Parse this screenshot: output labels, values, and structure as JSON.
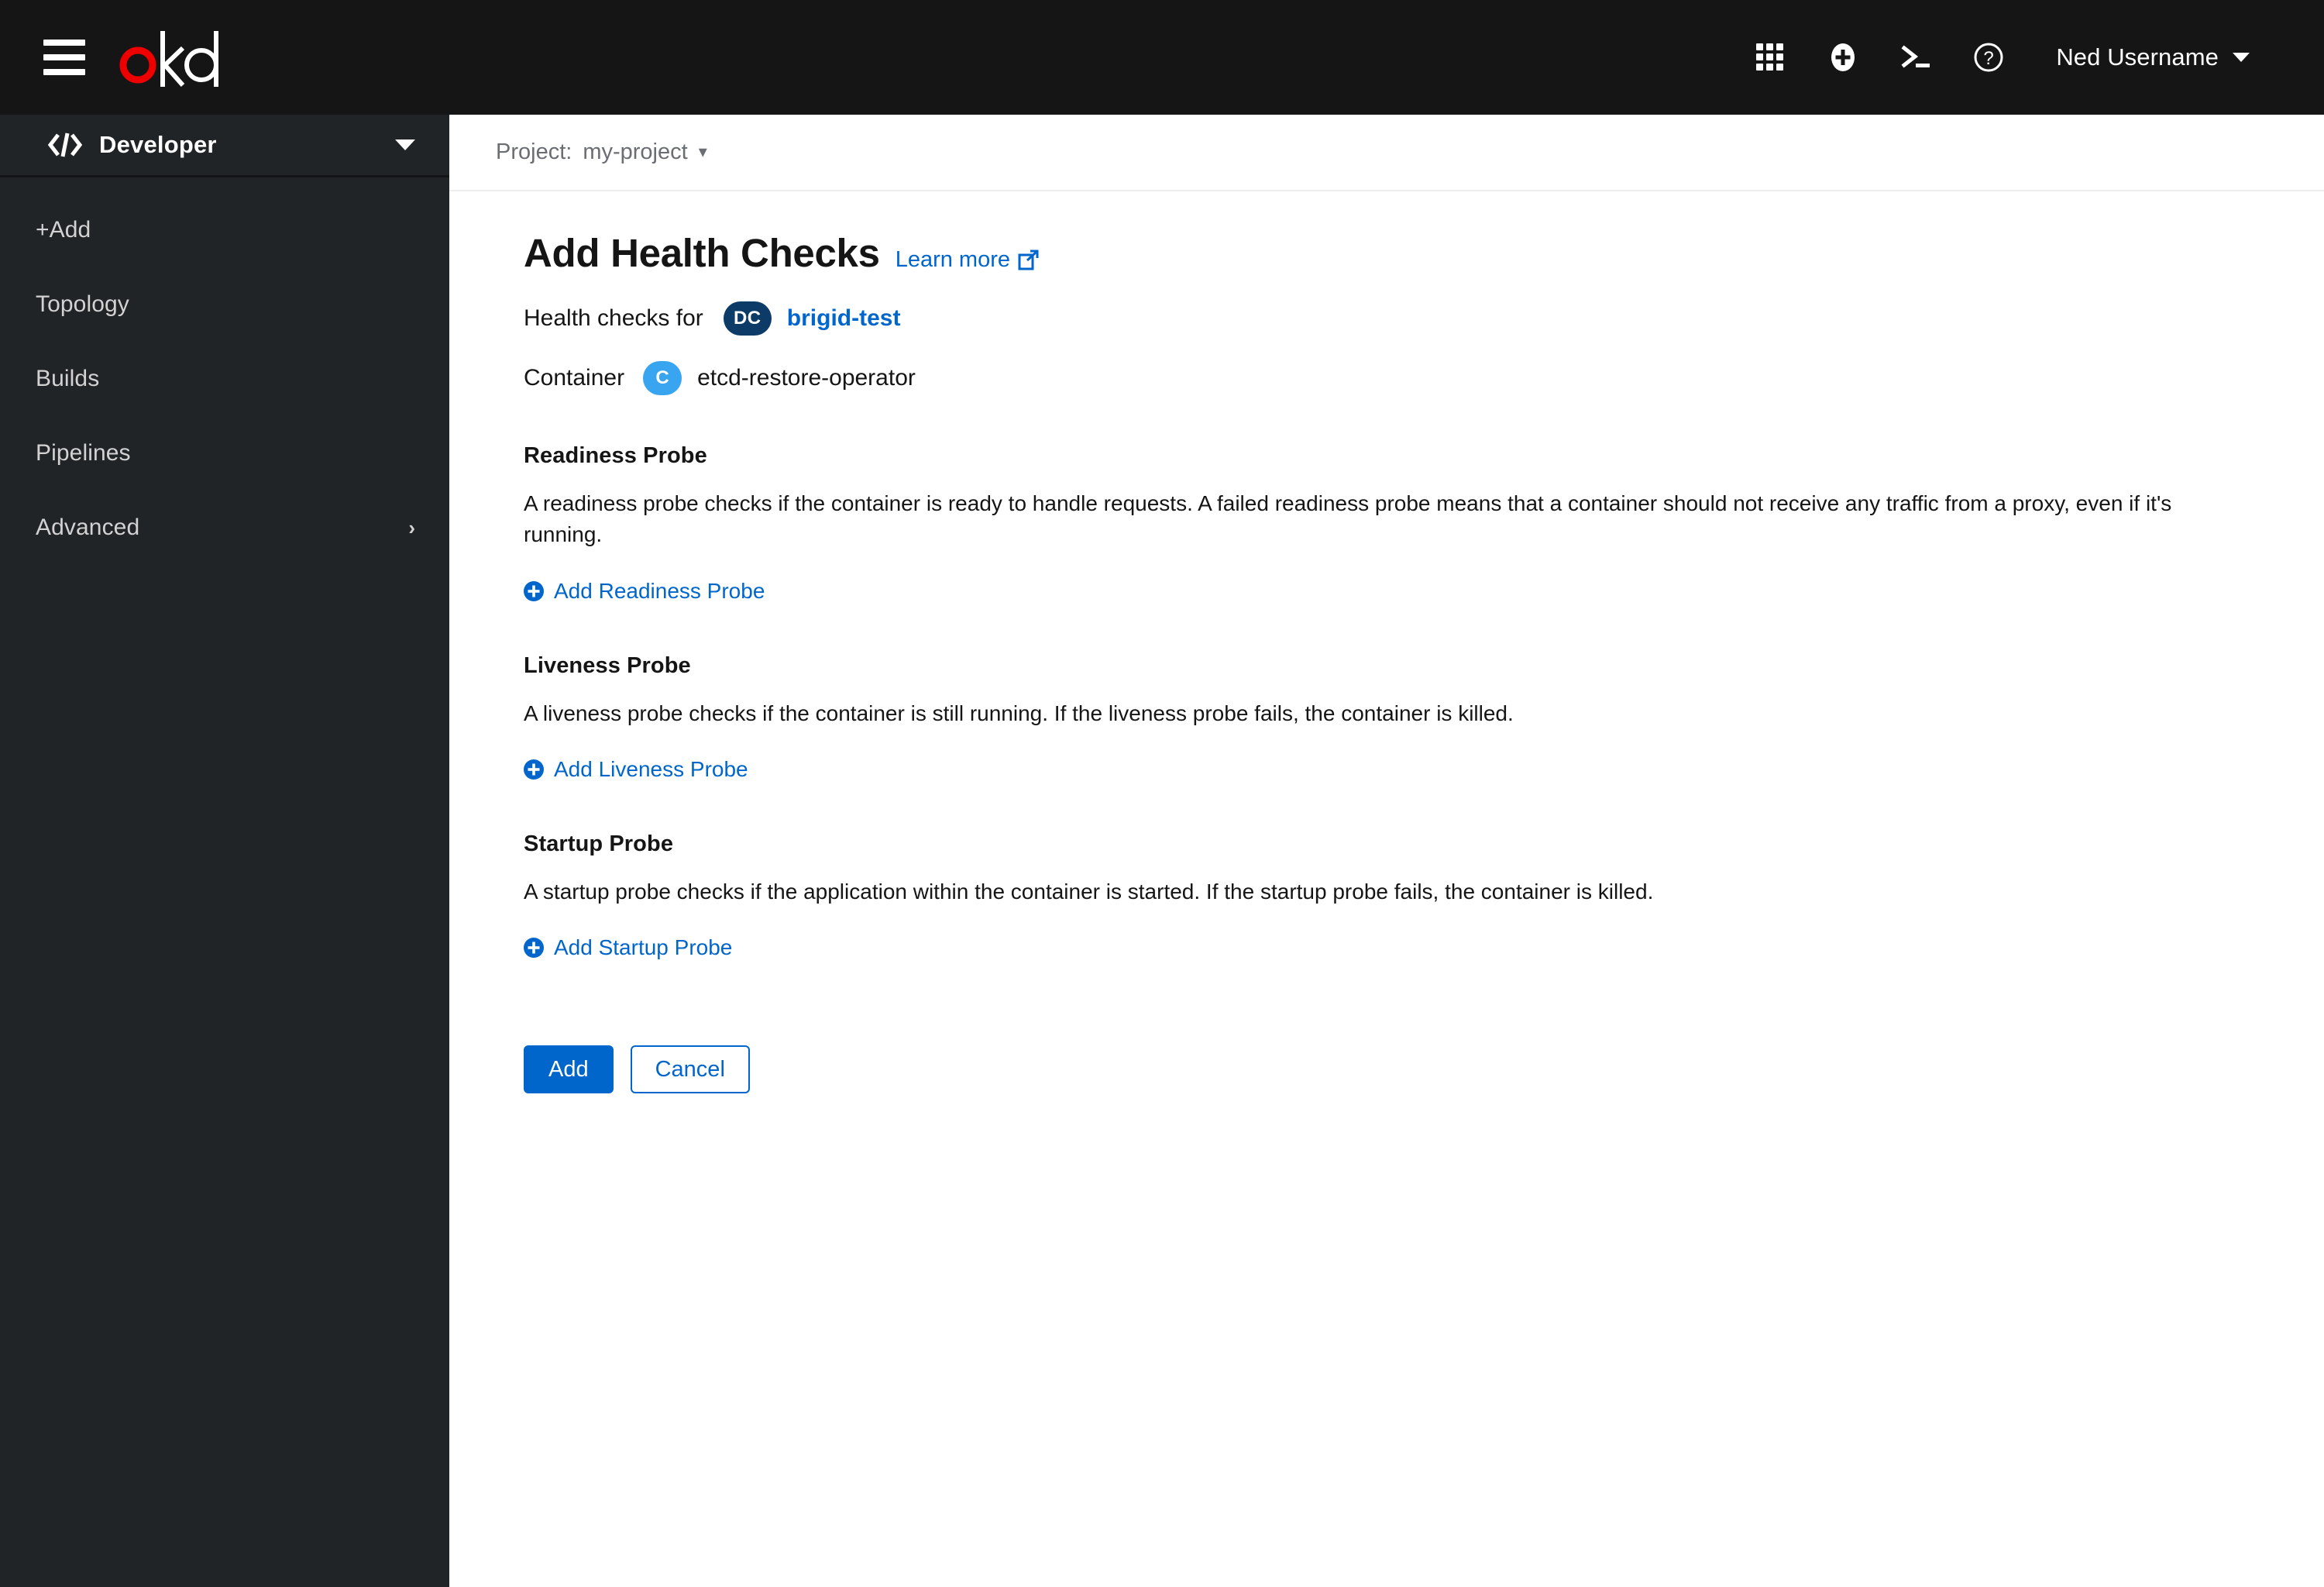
{
  "masthead": {
    "menu_icon": "hamburger-icon",
    "brand_name": "okd",
    "brand_colors": {
      "accent": "#ee0000",
      "text": "#ffffff"
    },
    "tools": [
      {
        "name": "application-launcher-icon",
        "label": "Application launcher"
      },
      {
        "name": "plus-circle-icon",
        "label": "Quick create"
      },
      {
        "name": "terminal-icon",
        "label": "Cloud shell"
      },
      {
        "name": "help-icon",
        "label": "Help"
      }
    ],
    "user": {
      "name": "Ned Username",
      "caret": "chevron-down-icon"
    }
  },
  "sidebar": {
    "perspective": {
      "icon": "code-icon",
      "label": "Developer",
      "caret": "chevron-down-icon"
    },
    "items": [
      {
        "label": "+Add",
        "has_chevron": false
      },
      {
        "label": "Topology",
        "has_chevron": false
      },
      {
        "label": "Builds",
        "has_chevron": false
      },
      {
        "label": "Pipelines",
        "has_chevron": false
      },
      {
        "label": "Advanced",
        "has_chevron": true,
        "chevron": "›"
      }
    ]
  },
  "project_bar": {
    "label": "Project:",
    "value": "my-project",
    "caret": "▾"
  },
  "page": {
    "title": "Add Health Checks",
    "learn_more": "Learn more",
    "learn_more_icon": "external-link-icon",
    "resource": {
      "prefix": "Health checks for",
      "badge": "DC",
      "badge_color": "#0b3b66",
      "name": "brigid-test",
      "name_color": "#0066cc"
    },
    "container": {
      "prefix": "Container",
      "badge": "C",
      "badge_color": "#39a5f0",
      "name": "etcd-restore-operator"
    },
    "probes": [
      {
        "title": "Readiness Probe",
        "description": "A readiness probe checks if the container is ready to handle requests. A failed readiness probe means that a container should not receive any traffic from a proxy, even if it's running.",
        "action_label": "Add Readiness Probe",
        "action_icon": "plus-circle-icon"
      },
      {
        "title": "Liveness Probe",
        "description": "A liveness probe checks if the container is still running. If the liveness probe fails, the container is killed.",
        "action_label": "Add Liveness Probe",
        "action_icon": "plus-circle-icon"
      },
      {
        "title": "Startup Probe",
        "description": "A startup probe checks if the application within the container is started. If the startup probe fails, the container is killed.",
        "action_label": "Add Startup Probe",
        "action_icon": "plus-circle-icon"
      }
    ],
    "buttons": {
      "submit": "Add",
      "cancel": "Cancel",
      "primary_color": "#0066cc"
    }
  }
}
